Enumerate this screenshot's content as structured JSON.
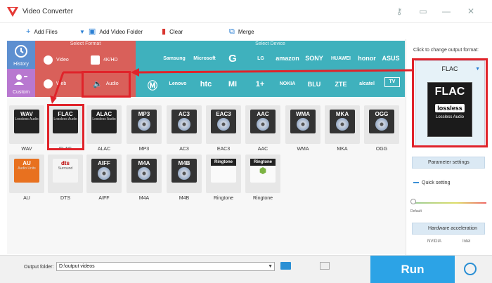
{
  "window": {
    "title": "Video Converter"
  },
  "toolbar": {
    "add_files": "Add Files",
    "add_video_folder": "Add Video Folder",
    "clear": "Clear",
    "merge": "Merge"
  },
  "sidebar": {
    "history": "History",
    "custom": "Custom"
  },
  "select_format": {
    "label": "Select Format",
    "video": "Video",
    "hd": "4K/HD",
    "web": "Web",
    "audio": "Audio"
  },
  "select_device": {
    "label": "Select Device",
    "row1": [
      "Samsung",
      "Microsoft",
      "G",
      "LG",
      "amazon",
      "SONY",
      "HUAWEI",
      "honor",
      "ASUS"
    ],
    "row2": [
      "Lenovo",
      "htc",
      "MI",
      "1+",
      "NOKIA",
      "BLU",
      "ZTE",
      "alcatel",
      "TV"
    ]
  },
  "formats": [
    {
      "code": "WAV",
      "sub": "Lossless Audio",
      "label": "WAV"
    },
    {
      "code": "FLAC",
      "sub": "Lossless Audio",
      "label": "FLAC"
    },
    {
      "code": "ALAC",
      "sub": "Lossless Audio",
      "label": "ALAC"
    },
    {
      "code": "MP3",
      "label": "MP3"
    },
    {
      "code": "AC3",
      "label": "AC3"
    },
    {
      "code": "EAC3",
      "label": "EAC3"
    },
    {
      "code": "AAC",
      "label": "AAC"
    },
    {
      "code": "WMA",
      "label": "WMA"
    },
    {
      "code": "MKA",
      "label": "MKA"
    },
    {
      "code": "OGG",
      "label": "OGG"
    },
    {
      "code": "AU",
      "sub": "Audio Units",
      "label": "AU"
    },
    {
      "code": "dts",
      "sub": "Surround",
      "label": "DTS"
    },
    {
      "code": "AIFF",
      "label": "AIFF"
    },
    {
      "code": "M4A",
      "label": "M4A"
    },
    {
      "code": "M4B",
      "label": "M4B"
    },
    {
      "code": "Ringtone",
      "label": "Ringtone"
    },
    {
      "code": "Ringtone",
      "label": "Ringtone"
    }
  ],
  "right_panel": {
    "hint": "Click to change output format:",
    "selected_format": "FLAC",
    "big_code": "FLAC",
    "big_badge": "lossless",
    "big_sub": "Lossless Audio",
    "param_settings": "Parameter settings",
    "quick_setting": "Quick setting",
    "default": "Default",
    "hw_accel": "Hardware acceleration",
    "nvidia": "NVIDIA",
    "intel": "Intel"
  },
  "bottom": {
    "output_folder_label": "Output folder:",
    "output_path": "D:\\output videos",
    "run": "Run"
  },
  "colors": {
    "format_bg": "#d9605a",
    "device_bg": "#3fb1bd",
    "history_bg": "#5d8fd0",
    "custom_bg": "#b878d0",
    "run_bg": "#2ca3e6",
    "annotation_red": "#e0232a"
  }
}
